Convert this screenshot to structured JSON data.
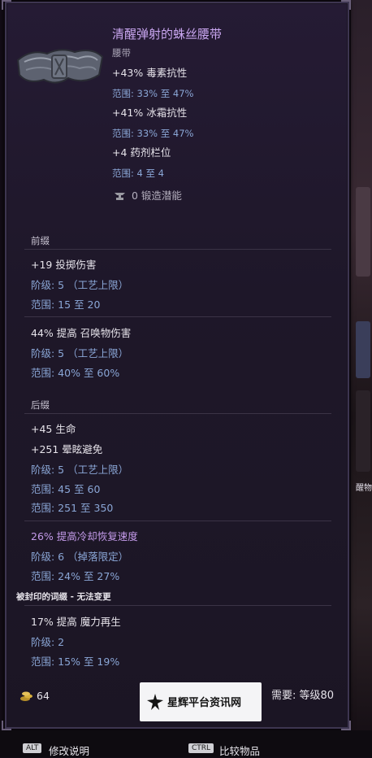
{
  "item": {
    "name": "清醒弹射的蛛丝腰带",
    "type": "腰带",
    "implicits": [
      {
        "stat": "+43% 毒素抗性",
        "range": "范围: 33% 至 47%"
      },
      {
        "stat": "+41% 冰霜抗性",
        "range": "范围: 33% 至 47%"
      },
      {
        "stat": "+4 药剂栏位",
        "range": "范围: 4 至 4"
      }
    ],
    "forging_potential": "0 锻造潜能"
  },
  "prefix": {
    "header": "前缀",
    "affixes": [
      {
        "stat": "+19 投掷伤害",
        "tier": "阶级: 5 （工艺上限）",
        "range": "范围: 15 至 20"
      },
      {
        "stat": "44% 提高 召唤物伤害",
        "tier": "阶级: 5 （工艺上限）",
        "range": "范围: 40% 至 60%"
      }
    ]
  },
  "suffix": {
    "header": "后缀",
    "affix1": {
      "stat1": "+45 生命",
      "stat2": "+251 晕眩避免",
      "tier": "阶级: 5 （工艺上限）",
      "range1": "范围: 45 至 60",
      "range2": "范围: 251 至 350"
    },
    "affix2": {
      "stat": "26% 提高冷却恢复速度",
      "tier": "阶级: 6 （掉落限定）",
      "range": "范围: 24% 至 27%"
    }
  },
  "sealed": {
    "header": "被封印的词缀 - 无法变更",
    "stat": "17% 提高 魔力再生",
    "tier": "阶级: 2",
    "range": "范围: 15% 至 19%"
  },
  "footer": {
    "gold": "64",
    "requirement": "需要: 等级80",
    "watermark": "星辉平台资讯网"
  },
  "bottom_bar": {
    "alt_key": "ALT",
    "alt_label": "修改说明",
    "ctrl_key": "CTRL",
    "ctrl_label": "比较物品"
  },
  "side_panel_text": "醒物",
  "icons": [
    "belt-icon",
    "anvil-icon",
    "gold-icon",
    "watermark-logo-icon"
  ],
  "colors": {
    "title": "#c9a6f0",
    "range": "#8aa6d6",
    "exalted": "#c49bea",
    "background": "#1e1729"
  }
}
